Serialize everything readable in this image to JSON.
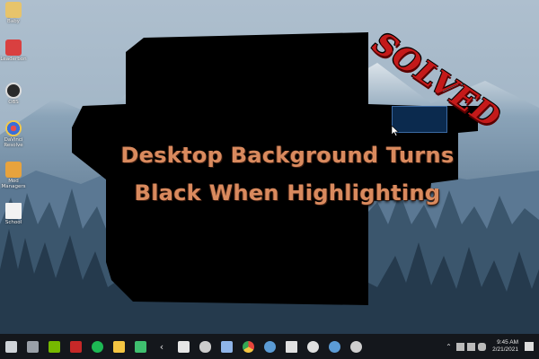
{
  "headline": {
    "line1": "Desktop Background Turns",
    "line2": "Black When Highlighting"
  },
  "stamp": "SOLVED",
  "desktop_icons": [
    {
      "label": "Baby",
      "icon": "folder-icon",
      "color": "#e7c46b"
    },
    {
      "label": "Leaderbon",
      "icon": "app-red-icon",
      "color": "#d94040"
    },
    {
      "label": "OBS",
      "icon": "obs-icon",
      "color": "#2a2a2a"
    },
    {
      "label": "DaVinci Resolve",
      "icon": "davinci-icon",
      "color": "#3a6fd8"
    },
    {
      "label": "Mod Managers",
      "icon": "mod-manager-icon",
      "color": "#e8a33d"
    },
    {
      "label": "School",
      "icon": "document-icon",
      "color": "#f2f2f2"
    }
  ],
  "taskbar_items": [
    {
      "name": "start-icon",
      "color": "#cfd3d8"
    },
    {
      "name": "task-view-icon",
      "color": "#9aa0a8"
    },
    {
      "name": "nvidia-icon",
      "color": "#76b900"
    },
    {
      "name": "app-red-icon",
      "color": "#c62828"
    },
    {
      "name": "spotify-icon",
      "color": "#1db954"
    },
    {
      "name": "file-explorer-icon",
      "color": "#f4c542"
    },
    {
      "name": "green-app-icon",
      "color": "#3fbf6f"
    },
    {
      "name": "back-arrow-icon",
      "color": "#dddddd"
    },
    {
      "name": "store-icon",
      "color": "#e6e6e6"
    },
    {
      "name": "game-controller-icon",
      "color": "#cccccc"
    },
    {
      "name": "mail-icon",
      "color": "#8fb4e8"
    },
    {
      "name": "chrome-icon",
      "color": "#e8453c"
    },
    {
      "name": "steam-icon",
      "color": "#5b9bd5"
    },
    {
      "name": "epic-games-icon",
      "color": "#e0e0e0"
    },
    {
      "name": "xbox-icon",
      "color": "#e0e0e0"
    },
    {
      "name": "steam-alt-icon",
      "color": "#5b9bd5"
    },
    {
      "name": "settings-icon",
      "color": "#cfcfcf"
    }
  ],
  "tray": {
    "time": "9:45 AM",
    "date": "2/21/2021"
  },
  "colors": {
    "sky": "#9ab0c2",
    "mountain": "#6f8aa2",
    "forest_far": "#3c5870",
    "forest_near": "#22374a",
    "artifact": "#000000",
    "headline": "#d98a5e",
    "stamp": "#c41a1a",
    "taskbar": "#14171c"
  }
}
